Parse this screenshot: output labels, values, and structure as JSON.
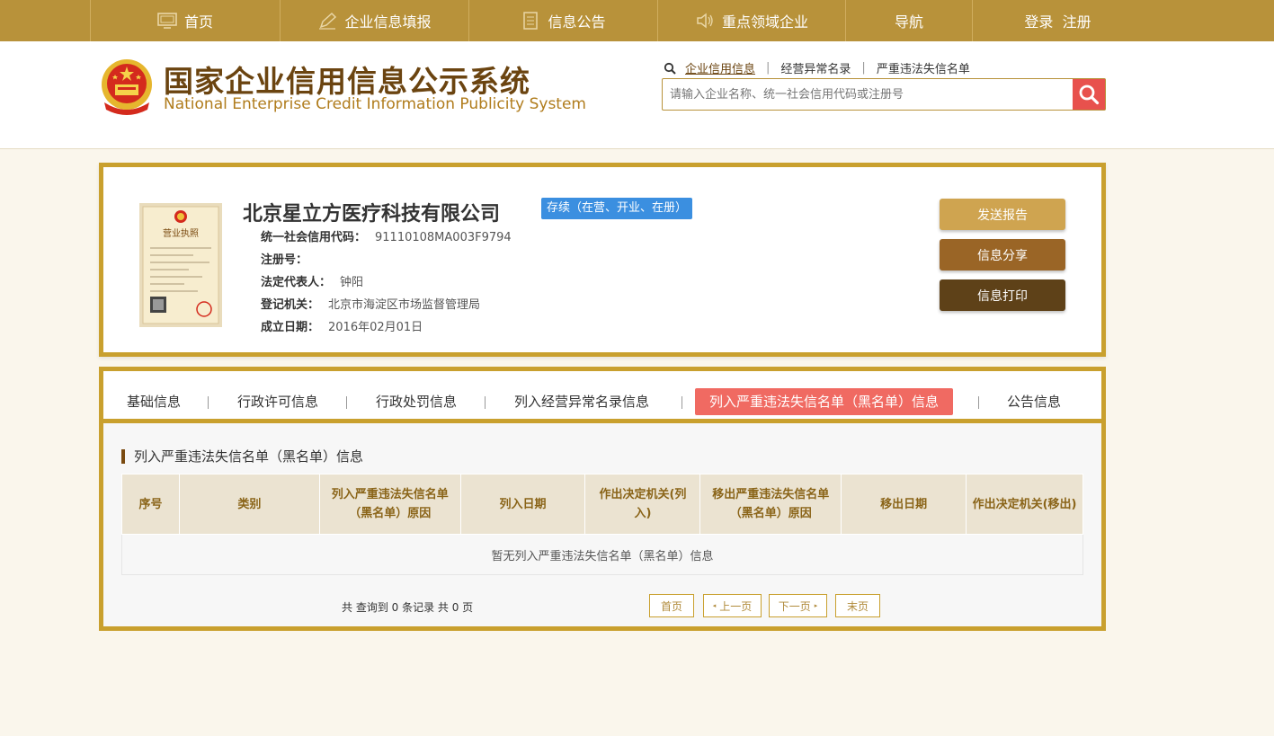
{
  "topnav": {
    "items": [
      {
        "label": "首页",
        "icon": "monitor-icon"
      },
      {
        "label": "企业信息填报",
        "icon": "pen-icon"
      },
      {
        "label": "信息公告",
        "icon": "document-icon"
      },
      {
        "label": "重点领域企业",
        "icon": "speaker-icon"
      },
      {
        "label": "导航"
      },
      {
        "label": "登录  注册"
      }
    ]
  },
  "header": {
    "title_cn": "国家企业信用信息公示系统",
    "title_en": "National Enterprise Credit Information Publicity System",
    "search_links": [
      "企业信用信息",
      "经营异常名录",
      "严重违法失信名单"
    ],
    "search_placeholder": "请输入企业名称、统一社会信用代码或注册号"
  },
  "company": {
    "name": "北京星立方医疗科技有限公司",
    "status": "存续（在营、开业、在册）",
    "license_title": "营业执照",
    "fields": [
      {
        "label": "统一社会信用代码：",
        "value": "91110108MA003F9794"
      },
      {
        "label": "注册号：",
        "value": ""
      },
      {
        "label": "法定代表人：",
        "value": "钟阳"
      },
      {
        "label": "登记机关：",
        "value": "北京市海淀区市场监督管理局"
      },
      {
        "label": "成立日期：",
        "value": "2016年02月01日"
      }
    ],
    "actions": [
      "发送报告",
      "信息分享",
      "信息打印"
    ]
  },
  "tabs": [
    "基础信息",
    "行政许可信息",
    "行政处罚信息",
    "列入经营异常名录信息",
    "列入严重违法失信名单（黑名单）信息",
    "公告信息"
  ],
  "section_title": "列入严重违法失信名单（黑名单）信息",
  "table": {
    "headers": [
      "序号",
      "类别",
      "列入严重违法失信名单（黑名单）原因",
      "列入日期",
      "作出决定机关(列入)",
      "移出严重违法失信名单（黑名单）原因",
      "移出日期",
      "作出决定机关(移出)"
    ],
    "empty_text": "暂无列入严重违法失信名单（黑名单）信息"
  },
  "pager": {
    "info": "共 查询到 0 条记录 共 0 页",
    "first": "首页",
    "prev": "上一页",
    "next": "下一页",
    "last": "末页"
  },
  "colors": {
    "nav_bg": "#b8923a",
    "accent_red": "#e8514d",
    "badge_blue": "#3b8fe0",
    "btn_send": "#cfa450",
    "btn_share": "#9a6526",
    "btn_print": "#5e4118"
  }
}
